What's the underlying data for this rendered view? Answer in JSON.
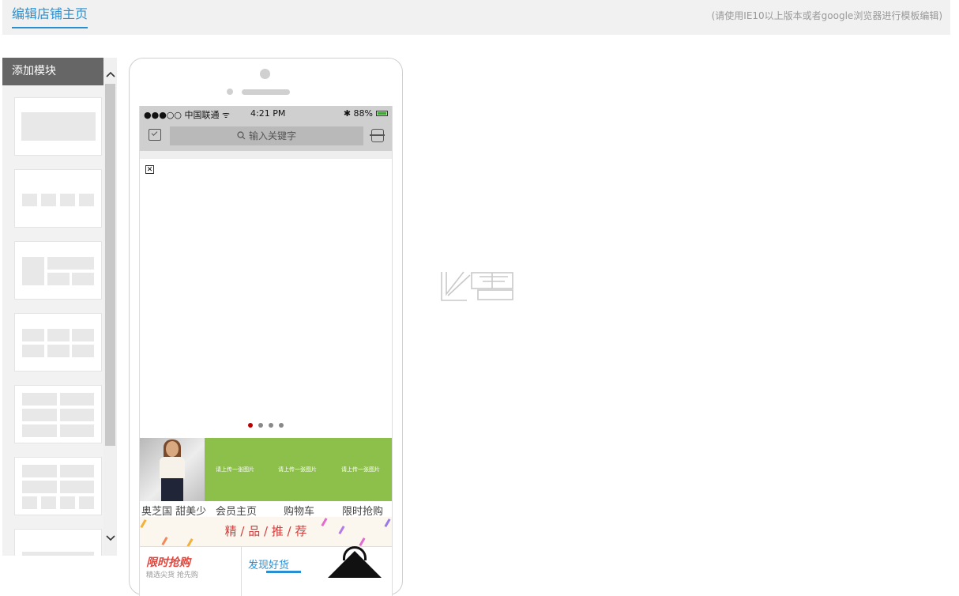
{
  "header": {
    "title": "编辑店铺主页",
    "hint": "(请使用IE10以上版本或者google浏览器进行模板编辑)"
  },
  "panel": {
    "title": "添加模块",
    "scroll_up": "⌃",
    "scroll_down": "⌄",
    "modules": [
      {
        "name": "banner-module"
      },
      {
        "name": "four-column-module"
      },
      {
        "name": "left-right-module"
      },
      {
        "name": "three-column-module"
      },
      {
        "name": "two-column-module"
      },
      {
        "name": "mixed-grid-module"
      },
      {
        "name": "list-module"
      }
    ]
  },
  "phone": {
    "status": {
      "carrier": "●●●○○ 中国联通 ᯤ",
      "time": "4:21 PM",
      "battery": "✱ 88%"
    },
    "search_placeholder": "输入关键字",
    "broken_image": "✕",
    "carousel": {
      "count": 4,
      "active": 0
    },
    "green_tiles": [
      "请上传一张图片",
      "请上传一张图片",
      "请上传一张图片"
    ],
    "nav_labels": [
      "奥芝国 甜美少",
      "会员主页",
      "购物车",
      "限时抢购"
    ],
    "recommend_title": "精 / 品 / 推 / 荐",
    "flash_sale": "限时抢购",
    "flash_sub": "精选尖货 抢先购",
    "discover": "发现好货"
  },
  "colors": {
    "accent": "#2a8fd0",
    "green_tile": "#8dc04a",
    "active_dot": "#bb0000"
  }
}
